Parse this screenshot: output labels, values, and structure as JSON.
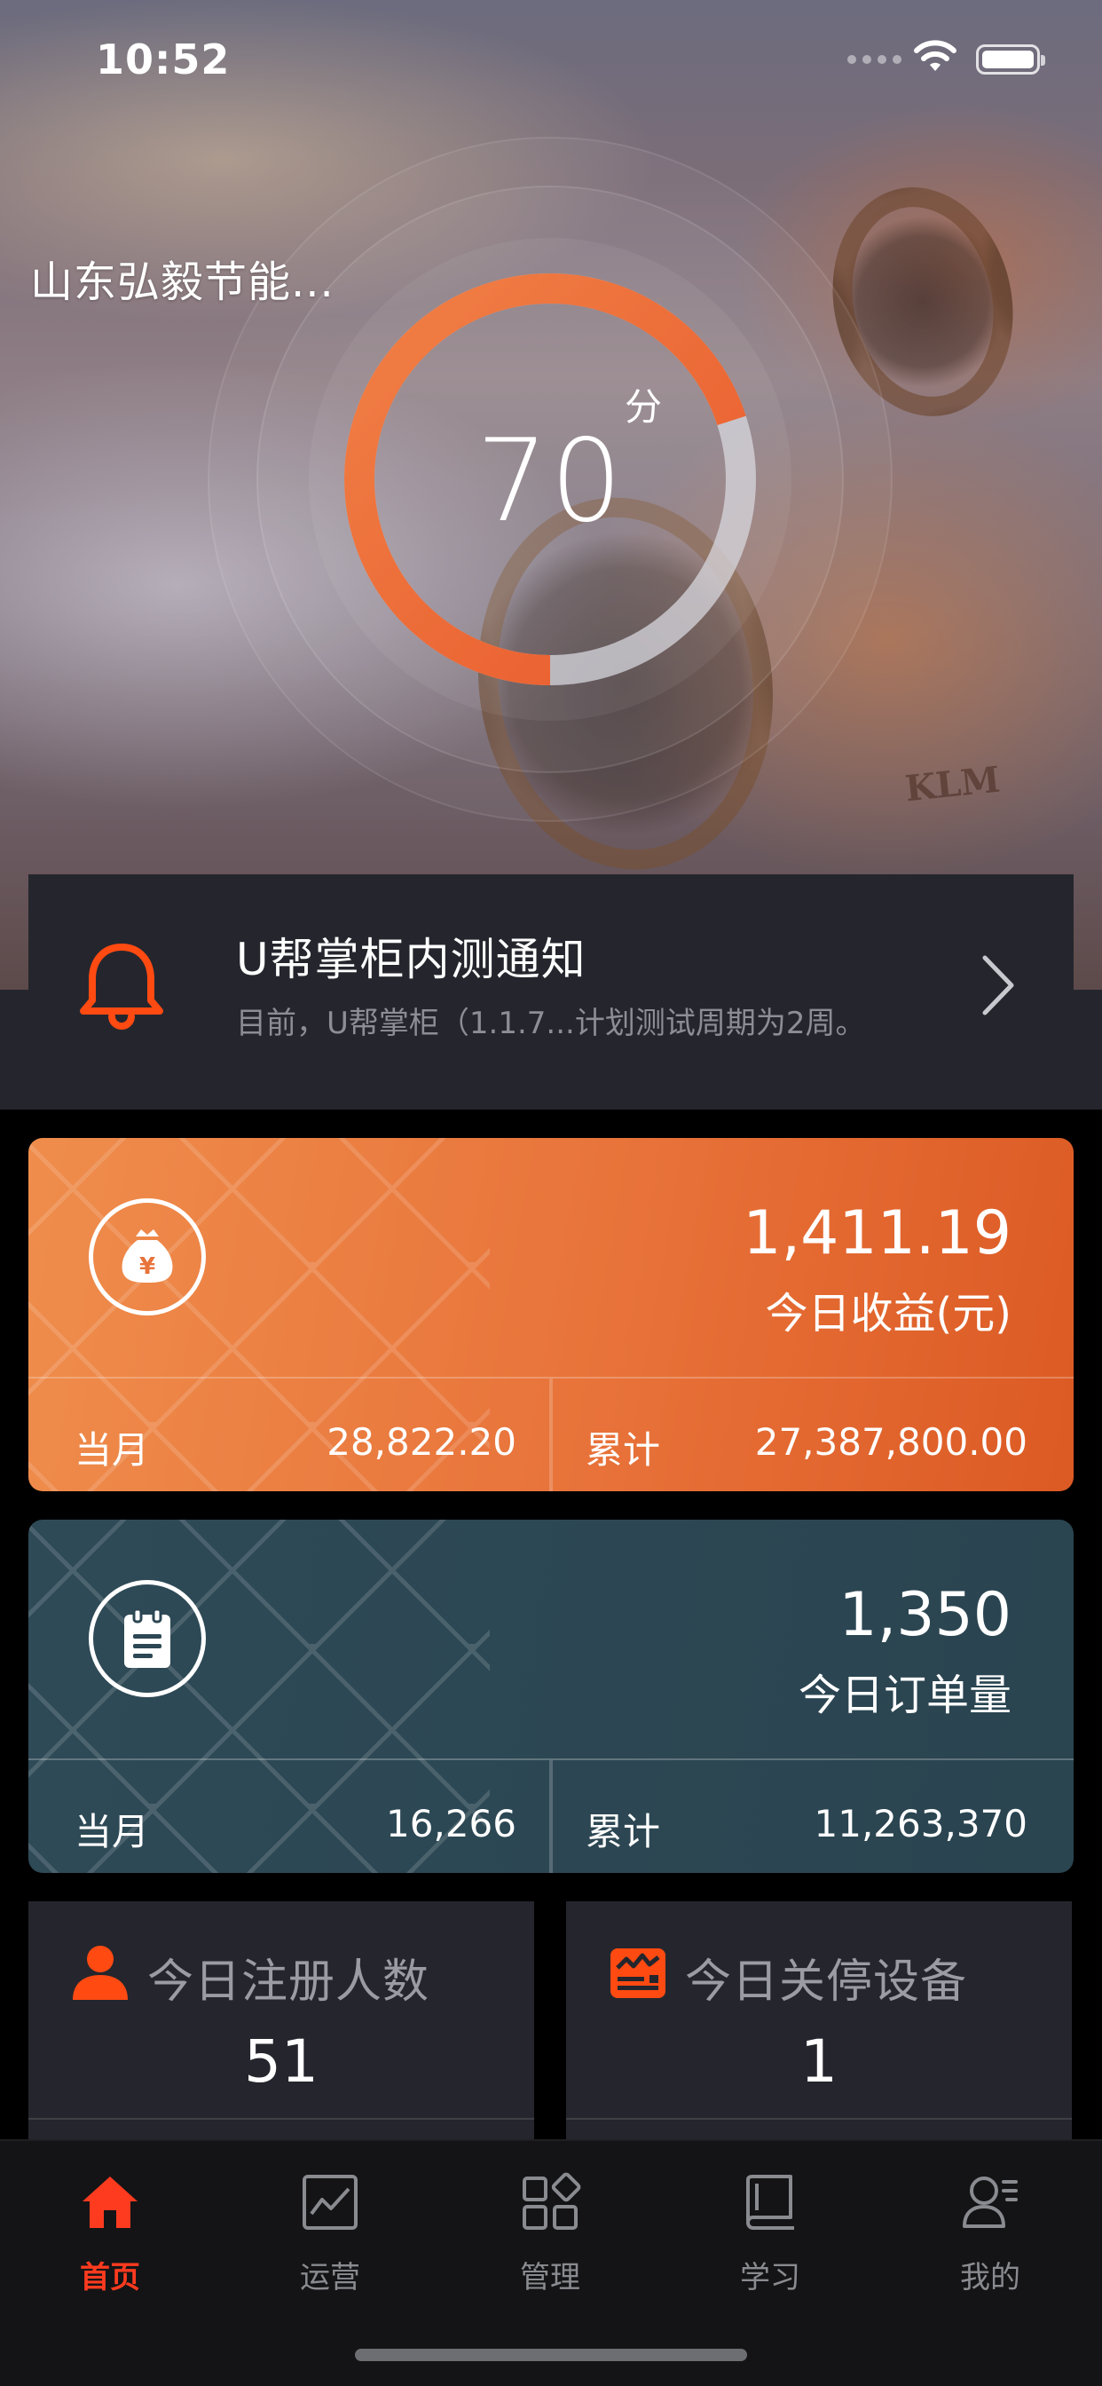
{
  "status_bar": {
    "time": "10:52"
  },
  "header": {
    "company_name": "山东弘毅节能...",
    "score": {
      "value": "70",
      "unit": "分",
      "fraction": 0.7
    }
  },
  "notice": {
    "title": "U帮掌柜内测通知",
    "text": "目前，U帮掌柜（1.1.7...计划测试周期为2周。",
    "icon": "bell-icon"
  },
  "revenue_card": {
    "value": "1,411.19",
    "label": "今日收益(元)",
    "month_label": "当月",
    "month_value": "28,822.20",
    "total_label": "累计",
    "total_value": "27,387,800.00",
    "icon": "money-bag-icon",
    "accent": "#E8733A"
  },
  "orders_card": {
    "value": "1,350",
    "label": "今日订单量",
    "month_label": "当月",
    "month_value": "16,266",
    "total_label": "累计",
    "total_value": "11,263,370",
    "icon": "clipboard-icon",
    "accent": "#2C4753"
  },
  "registrations_card": {
    "label": "今日注册人数",
    "value": "51",
    "icon": "user-icon"
  },
  "shutdown_card": {
    "label": "今日关停设备",
    "value": "1",
    "icon": "device-alert-icon"
  },
  "tab_bar": {
    "active_color": "#FF3B1F",
    "items": [
      {
        "label": "首页",
        "icon": "home-icon",
        "active": true
      },
      {
        "label": "运营",
        "icon": "chart-icon",
        "active": false
      },
      {
        "label": "管理",
        "icon": "grid-icon",
        "active": false
      },
      {
        "label": "学习",
        "icon": "book-icon",
        "active": false
      },
      {
        "label": "我的",
        "icon": "profile-icon",
        "active": false
      }
    ]
  }
}
